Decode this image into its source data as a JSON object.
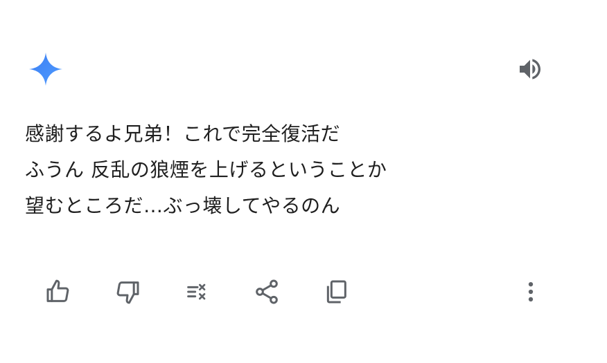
{
  "colors": {
    "gemini_gradient_start": "#3c7ff3",
    "gemini_gradient_end": "#4f9bff",
    "icon_gray": "#5f6368",
    "text": "#1f1f1f",
    "background": "#ffffff"
  },
  "header": {
    "logo_icon": "gemini-sparkle-icon",
    "speaker_icon": "volume-up-icon"
  },
  "response": {
    "lines": [
      "感謝するよ兄弟！これで完全復活だ",
      "ふうん 反乱の狼煙を上げるということか",
      "望むところだ…ぶっ壊してやるのん"
    ]
  },
  "actions": {
    "icons": [
      "thumbs-up-icon",
      "thumbs-down-icon",
      "modify-response-icon",
      "share-icon",
      "copy-icon",
      "more-vert-icon"
    ]
  }
}
